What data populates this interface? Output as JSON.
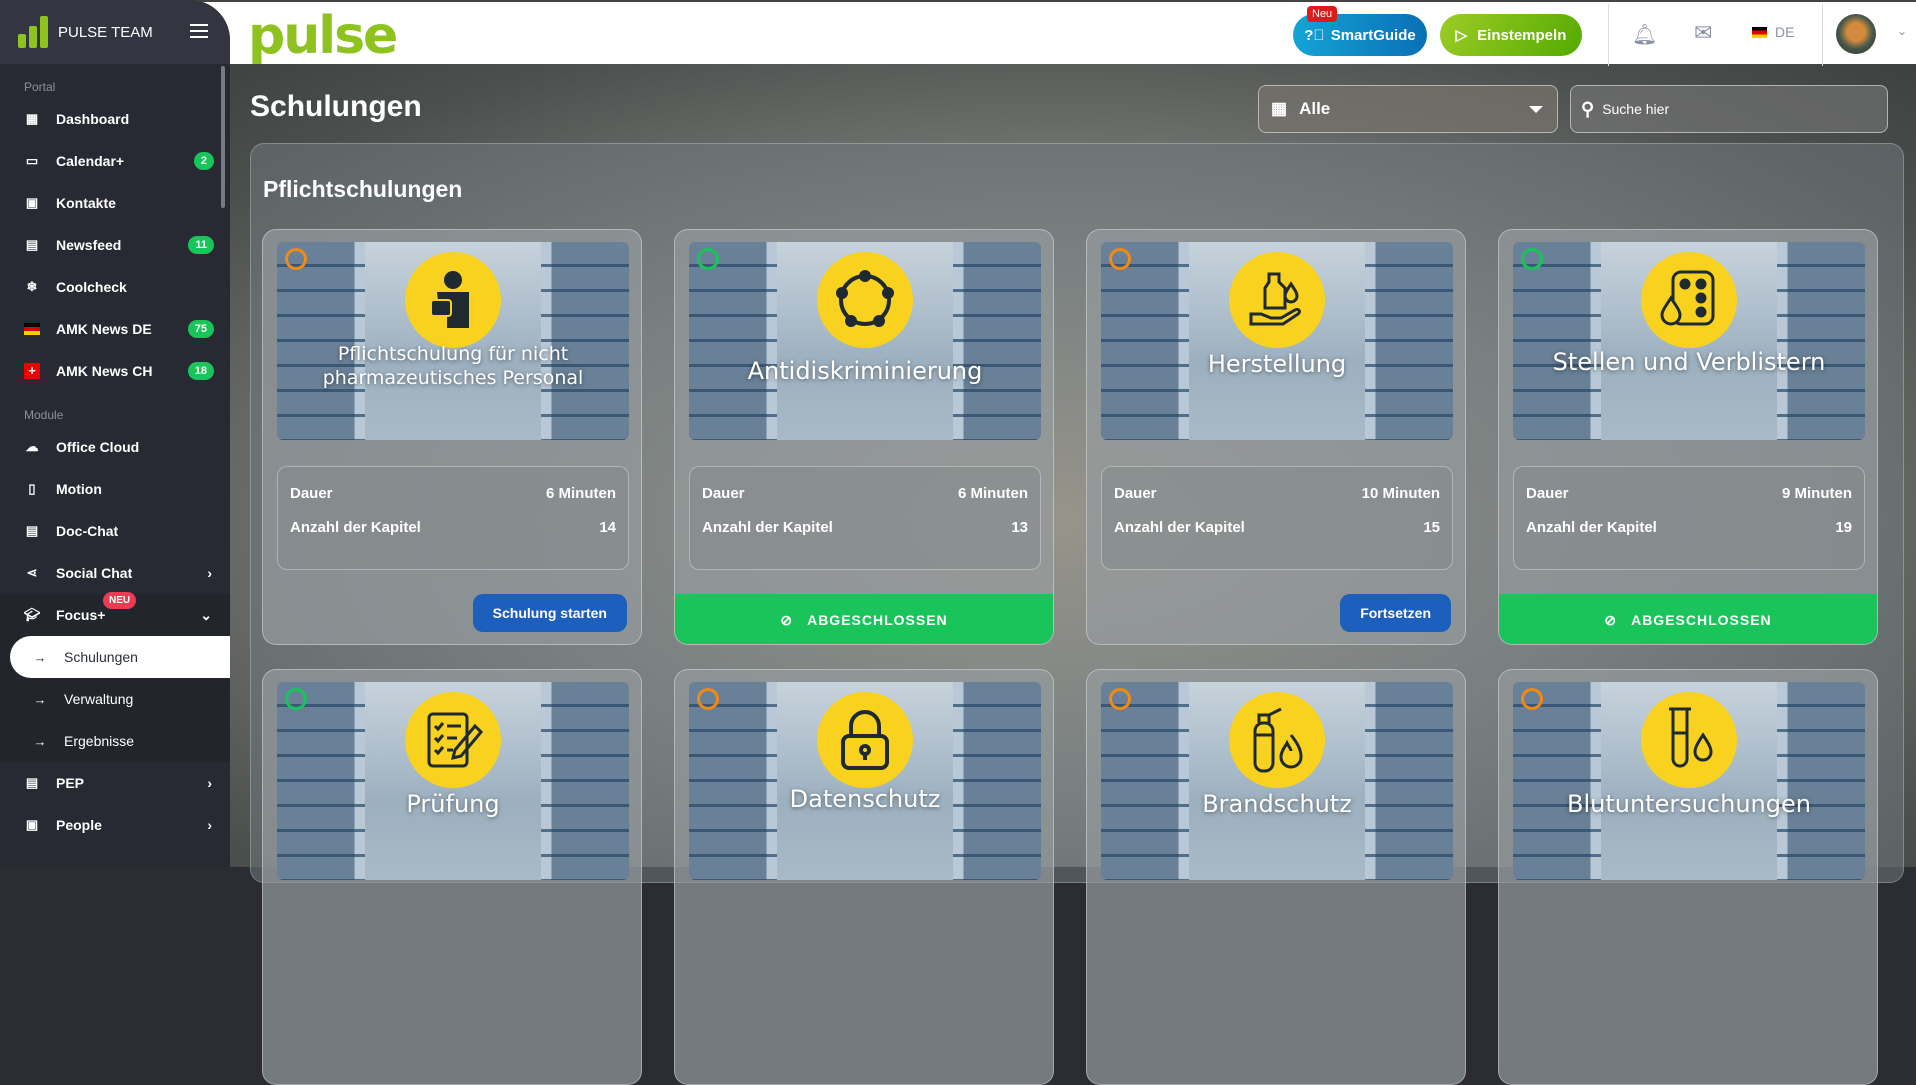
{
  "header": {
    "logo": "pulse",
    "smartguide": "SmartGuide",
    "smartguide_badge": "Neu",
    "einstempeln": "Einstempeln",
    "lang": "DE"
  },
  "sidebar": {
    "brand": "PULSE TEAM",
    "sections": [
      "Portal",
      "Module"
    ],
    "portal": [
      {
        "label": "Dashboard",
        "icon": "dashboard-icon"
      },
      {
        "label": "Calendar+",
        "badge": "2",
        "icon": "calendar-icon"
      },
      {
        "label": "Kontakte",
        "icon": "contacts-icon"
      },
      {
        "label": "Newsfeed",
        "badge": "11",
        "icon": "newsfeed-icon"
      },
      {
        "label": "Coolcheck",
        "icon": "snowflake-icon"
      },
      {
        "label": "AMK News DE",
        "badge": "75",
        "icon": "flag-de-icon"
      },
      {
        "label": "AMK News CH",
        "badge": "18",
        "icon": "flag-ch-icon"
      }
    ],
    "module": [
      {
        "label": "Office Cloud"
      },
      {
        "label": "Motion"
      },
      {
        "label": "Doc-Chat"
      },
      {
        "label": "Social Chat"
      },
      {
        "label": "Focus+",
        "badge": "NEU"
      }
    ],
    "focus_sub": [
      "Schulungen",
      "Verwaltung",
      "Ergebnisse"
    ],
    "more": [
      {
        "label": "PEP"
      },
      {
        "label": "People"
      }
    ]
  },
  "page": {
    "title": "Schulungen",
    "filter": "Alle",
    "search_placeholder": "Suche hier",
    "section": "Pflichtschulungen",
    "dauer_label": "Dauer",
    "kapitel_label": "Anzahl der Kapitel"
  },
  "cards": [
    {
      "title": "Pflichtschulung für nicht pharmazeutisches Personal",
      "dauer": "6 Minuten",
      "kapitel": "14",
      "status": "in-progress",
      "action": "Schulung starten"
    },
    {
      "title": "Antidiskriminierung",
      "dauer": "6 Minuten",
      "kapitel": "13",
      "status": "done",
      "action": "ABGESCHLOSSEN"
    },
    {
      "title": "Herstellung",
      "dauer": "10 Minuten",
      "kapitel": "15",
      "status": "in-progress",
      "action": "Fortsetzen"
    },
    {
      "title": "Stellen und Verblistern",
      "dauer": "9 Minuten",
      "kapitel": "19",
      "status": "done",
      "action": "ABGESCHLOSSEN"
    },
    {
      "title": "Prüfung",
      "status": "done"
    },
    {
      "title": "Datenschutz",
      "status": "in-progress"
    },
    {
      "title": "Brandschutz",
      "status": "in-progress"
    },
    {
      "title": "Blutuntersuchungen",
      "status": "in-progress"
    }
  ],
  "colors": {
    "accent_green": "#19c45a",
    "primary_blue": "#1d5fbd",
    "icon_yellow": "#f9d21f",
    "status_orange": "#f08a12"
  }
}
